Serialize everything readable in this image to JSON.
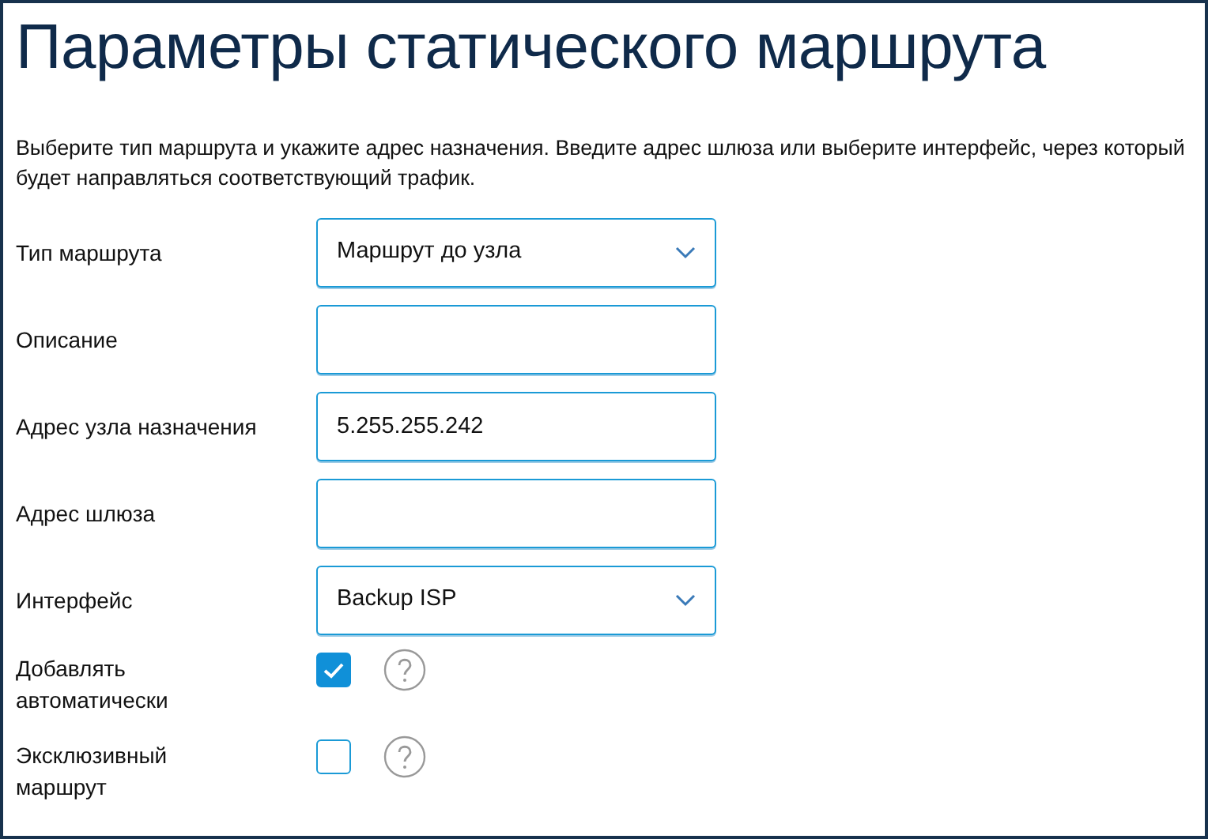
{
  "title": "Параметры статического маршрута",
  "description": "Выберите тип маршрута и укажите адрес назначения. Введите адрес шлюза или выберите интерфейс, через который будет направляться соответствующий трафик.",
  "fields": [
    {
      "kind": "select",
      "label": "Тип маршрута",
      "value": "Маршрут до узла"
    },
    {
      "kind": "text",
      "label": "Описание"
    },
    {
      "kind": "text",
      "label": "Адрес узла назначения",
      "value": "5.255.255.242"
    },
    {
      "kind": "text",
      "label": "Адрес шлюза"
    },
    {
      "kind": "select",
      "label": "Интерфейс",
      "value": "Backup ISP"
    },
    {
      "kind": "checkbox",
      "label": "Добавлять автоматически",
      "checked": true
    },
    {
      "kind": "checkbox",
      "label": "Эксклюзивный маршрут",
      "checked": false
    }
  ]
}
